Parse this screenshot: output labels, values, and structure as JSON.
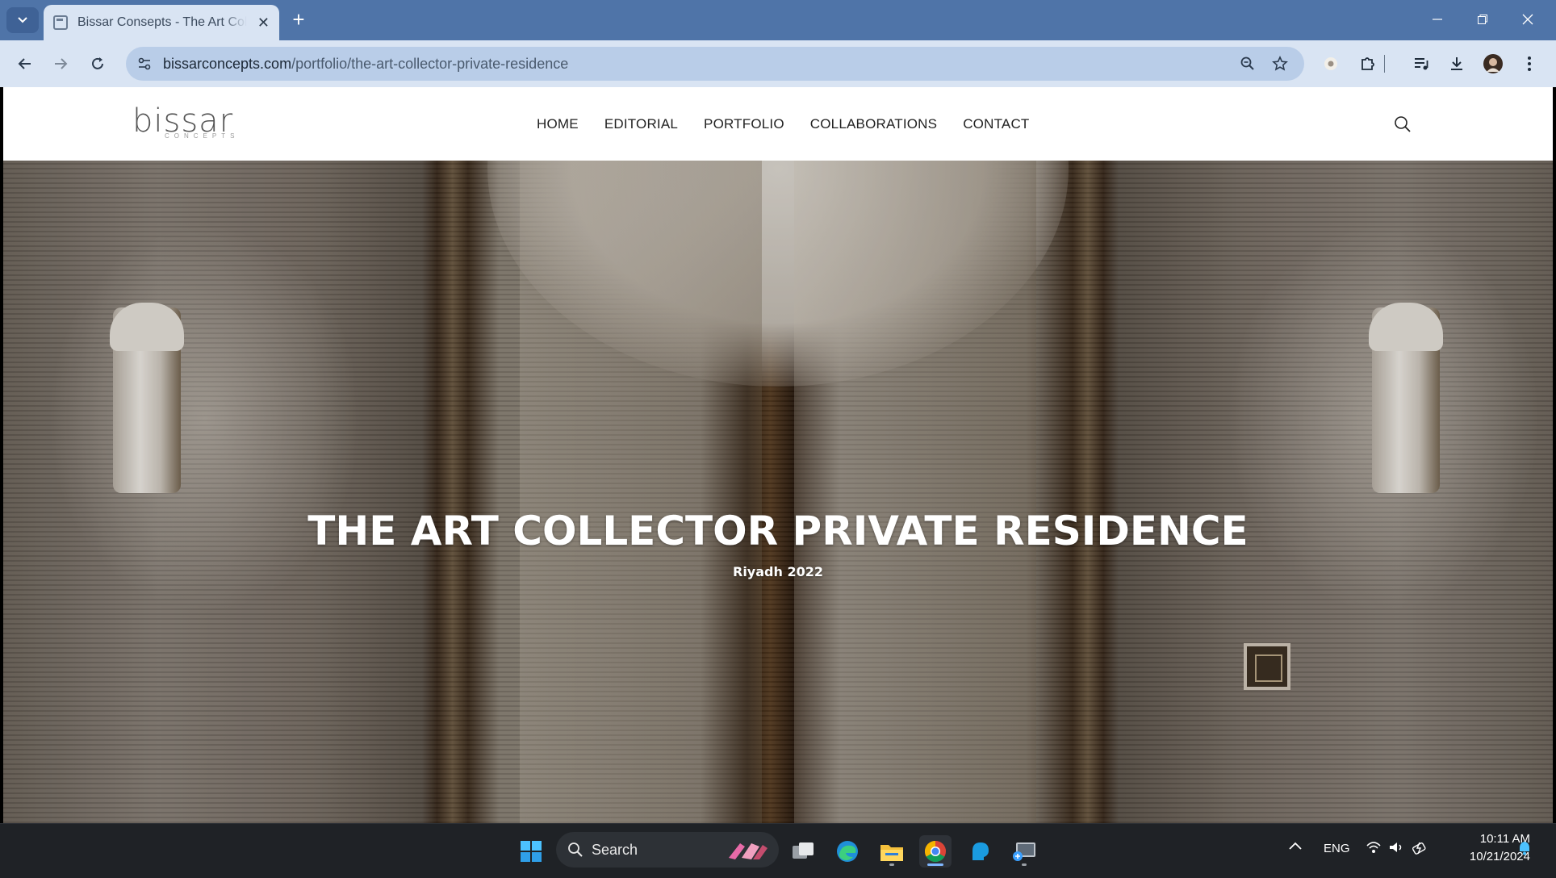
{
  "browser": {
    "tab_title": "Bissar Consepts - The Art Collector Private Residence",
    "url_host": "bissarconcepts.com",
    "url_path": "/portfolio/the-art-collector-private-residence"
  },
  "site": {
    "logo_text": "bissar",
    "logo_subtext": "CONCEPTS",
    "nav": [
      {
        "label": "HOME"
      },
      {
        "label": "EDITORIAL"
      },
      {
        "label": "PORTFOLIO"
      },
      {
        "label": "COLLABORATIONS"
      },
      {
        "label": "CONTACT"
      }
    ]
  },
  "hero": {
    "title": "THE ART COLLECTOR PRIVATE RESIDENCE",
    "subtitle": "Riyadh 2022"
  },
  "taskbar": {
    "search_label": "Search",
    "language": "ENG",
    "time": "10:11 AM",
    "date": "10/21/2024"
  },
  "colors": {
    "chrome_title": "#4f74a8",
    "chrome_toolbar": "#d9e4f3",
    "omnibox": "#b9cde8",
    "taskbar": "#1f2226"
  }
}
